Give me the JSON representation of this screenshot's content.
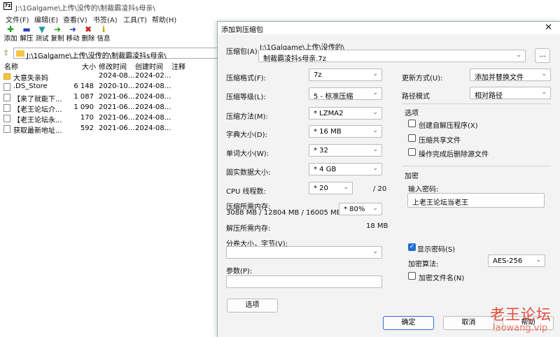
{
  "fm": {
    "title": "J:\\1Galgame\\上传\\没传的\\制裁霸凌抖s母亲\\",
    "app_icon": "7z",
    "menu": [
      "文件(F)",
      "编辑(E)",
      "查看(V)",
      "书签(A)",
      "工具(T)",
      "帮助(H)"
    ],
    "tools": [
      {
        "label": "添加",
        "icon": "plus-icon",
        "glyph": "✚",
        "color": "#1aa11a"
      },
      {
        "label": "解压",
        "icon": "minus-icon",
        "glyph": "▬",
        "color": "#2a3fbf"
      },
      {
        "label": "测试",
        "icon": "test-icon",
        "glyph": "▼",
        "color": "#1aa0a0"
      },
      {
        "label": "复制",
        "icon": "copy-arrow-icon",
        "glyph": "➜",
        "color": "#1aa11a"
      },
      {
        "label": "移动",
        "icon": "move-arrow-icon",
        "glyph": "➜",
        "color": "#2a3fbf"
      },
      {
        "label": "删除",
        "icon": "delete-icon",
        "glyph": "✖",
        "color": "#d01515"
      },
      {
        "label": "信息",
        "icon": "info-icon",
        "glyph": "ℹ",
        "color": "#c8a000"
      }
    ],
    "address": "J:\\1Galgame\\上传\\没传的\\制裁霸凌抖s母亲\\",
    "columns": {
      "name": "名称",
      "size": "大小",
      "modified": "修改时间",
      "created": "创建时间",
      "comment": "注释"
    },
    "files": [
      {
        "name": "大意失亲妈",
        "size": "",
        "modified": "2024-08...",
        "created": "2024-02...",
        "folder": true
      },
      {
        "name": ".DS_Store",
        "size": "6 148",
        "modified": "2020-10...",
        "created": "2024-08...",
        "folder": false
      },
      {
        "name": "【来了就能下...",
        "size": "1 087",
        "modified": "2021-06...",
        "created": "2024-08...",
        "folder": false
      },
      {
        "name": "【老王论坛介...",
        "size": "1 090",
        "modified": "2021-06...",
        "created": "2024-08...",
        "folder": false
      },
      {
        "name": "【老王论坛永...",
        "size": "170",
        "modified": "2021-06...",
        "created": "2024-08...",
        "folder": false
      },
      {
        "name": "获取最新地址...",
        "size": "592",
        "modified": "2021-06...",
        "created": "2024-08...",
        "folder": false
      }
    ]
  },
  "dialog": {
    "title": "添加到压缩包",
    "archive_label": "压缩包(A):",
    "archive_dir": "J:\\1Galgame\\上传\\没传的\\",
    "archive_name": "制裁霸凌抖s母亲.7z",
    "browse_label": "...",
    "format_label": "压缩格式(F):",
    "format_value": "7z",
    "level_label": "压缩等级(L):",
    "level_value": "5 - 标准压缩",
    "method_label": "压缩方法(M):",
    "method_value": "* LZMA2",
    "dict_label": "字典大小(D):",
    "dict_value": "* 16 MB",
    "word_label": "单词大小(W):",
    "word_value": "* 32",
    "solid_label": "固实数据大小:",
    "solid_value": "* 4 GB",
    "threads_label": "CPU 线程数:",
    "threads_value": "* 20",
    "threads_total": "/ 20",
    "mem_label": "压缩所需内存:",
    "mem_detail": "3088 MB / 12804 MB / 16005 MB",
    "mem_value": "* 80%",
    "decomp_label": "解压所需内存:",
    "decomp_value": "18 MB",
    "split_label": "分卷大小，字节(V):",
    "split_value": "",
    "params_label": "参数(P):",
    "params_value": "",
    "options_button": "选项",
    "update_label": "更新方式(U):",
    "update_value": "添加并替换文件",
    "pathmode_label": "路径模式",
    "pathmode_value": "相对路径",
    "options_group": "选项",
    "opt_sfx": "创建自解压程序(X)",
    "opt_shared": "压缩共享文件",
    "opt_delete": "操作完成后删除源文件",
    "encrypt_group": "加密",
    "password_label": "输入密码:",
    "password_value": "上老王论坛当老王",
    "show_password": "显示密码(S)",
    "enc_method_label": "加密算法:",
    "enc_method_value": "AES-256",
    "encrypt_names": "加密文件名(N)",
    "ok": "确定",
    "cancel": "取消",
    "help": "帮助"
  },
  "watermark": {
    "line1": "老王论坛",
    "line2": "laowang.vip"
  }
}
